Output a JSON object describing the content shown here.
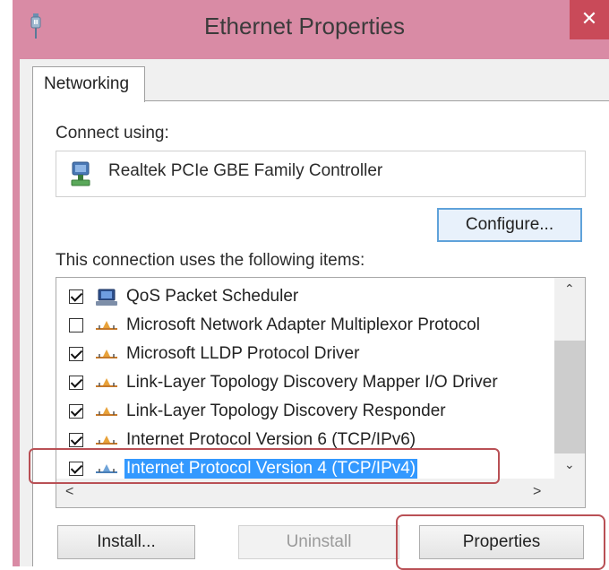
{
  "window": {
    "title": "Ethernet Properties",
    "close_glyph": "✕",
    "accent_color": "#d98ba5",
    "close_color": "#c94a59"
  },
  "tabs": [
    {
      "label": "Networking",
      "active": true
    }
  ],
  "connect_using": {
    "label": "Connect using:",
    "adapter": "Realtek PCIe GBE Family Controller",
    "adapter_icon": "network-adapter-icon",
    "configure_label": "Configure..."
  },
  "items_section": {
    "label": "This connection uses the following items:",
    "items": [
      {
        "label": "QoS Packet Scheduler",
        "checked": true,
        "icon": "qos-scheduler-icon"
      },
      {
        "label": "Microsoft Network Adapter Multiplexor Protocol",
        "checked": false,
        "icon": "protocol-icon"
      },
      {
        "label": "Microsoft LLDP Protocol Driver",
        "checked": true,
        "icon": "protocol-icon"
      },
      {
        "label": "Link-Layer Topology Discovery Mapper I/O Driver",
        "checked": true,
        "icon": "protocol-icon"
      },
      {
        "label": "Link-Layer Topology Discovery Responder",
        "checked": true,
        "icon": "protocol-icon"
      },
      {
        "label": "Internet Protocol Version 6 (TCP/IPv6)",
        "checked": true,
        "icon": "protocol-icon"
      },
      {
        "label": "Internet Protocol Version 4 (TCP/IPv4)",
        "checked": true,
        "icon": "protocol-icon",
        "selected": true
      }
    ]
  },
  "buttons": {
    "install": "Install...",
    "uninstall": "Uninstall",
    "properties": "Properties"
  },
  "scroll_glyphs": {
    "up": "⌃",
    "down": "⌄",
    "left": "<",
    "right": ">"
  }
}
